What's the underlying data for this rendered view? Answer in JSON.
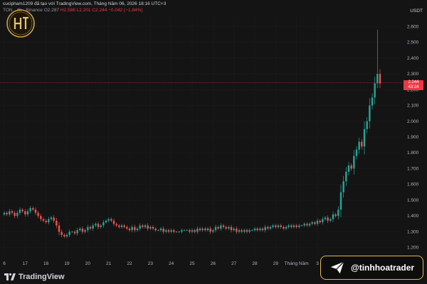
{
  "header": {
    "title": "cucipham1209 đã tạo với TradingView.com, Tháng Năm 06, 2026 18:16 UTC+3",
    "symbol_line": "TON · 4h · Binance",
    "ohlc": {
      "o": "O2.287",
      "h": "H2.586",
      "l": "L2.201",
      "c": "C2.244",
      "chg": "−0.042 (−1.84%)"
    },
    "currency": "USDT"
  },
  "price_tag": {
    "price": "2.244",
    "time": "43:24"
  },
  "footer": {
    "brand": "TradingView"
  },
  "badge": {
    "handle": "@tinhhoatrader",
    "icon": "send-icon"
  },
  "colors": {
    "up": "#26a69a",
    "down": "#ef5350",
    "bg": "#141414",
    "accent": "#e6b84a"
  },
  "chart_data": {
    "type": "candlestick",
    "y_ticks": [
      "2.600",
      "2.500",
      "2.400",
      "2.300",
      "2.200",
      "2.100",
      "2.000",
      "1.900",
      "1.800",
      "1.700",
      "1.600",
      "1.500",
      "1.400",
      "1.300",
      "1.200"
    ],
    "ylim": [
      1.14,
      2.66
    ],
    "x_ticks": [
      "6",
      "17",
      "18",
      "19",
      "20",
      "21",
      "22",
      "23",
      "24",
      "25",
      "26",
      "27",
      "28",
      "29",
      "Tháng Năm",
      "3"
    ],
    "last_price": 2.244,
    "closes": [
      1.42,
      1.41,
      1.43,
      1.42,
      1.4,
      1.42,
      1.44,
      1.43,
      1.41,
      1.43,
      1.45,
      1.44,
      1.42,
      1.4,
      1.38,
      1.37,
      1.36,
      1.38,
      1.39,
      1.37,
      1.34,
      1.3,
      1.28,
      1.27,
      1.28,
      1.3,
      1.3,
      1.29,
      1.31,
      1.32,
      1.3,
      1.31,
      1.33,
      1.32,
      1.34,
      1.35,
      1.33,
      1.34,
      1.36,
      1.37,
      1.38,
      1.37,
      1.35,
      1.34,
      1.33,
      1.34,
      1.33,
      1.32,
      1.31,
      1.33,
      1.31,
      1.32,
      1.34,
      1.33,
      1.34,
      1.32,
      1.33,
      1.32,
      1.31,
      1.31,
      1.32,
      1.3,
      1.31,
      1.3,
      1.31,
      1.3,
      1.3,
      1.3,
      1.31,
      1.31,
      1.31,
      1.3,
      1.31,
      1.3,
      1.32,
      1.31,
      1.32,
      1.31,
      1.32,
      1.3,
      1.31,
      1.33,
      1.32,
      1.34,
      1.33,
      1.32,
      1.33,
      1.31,
      1.32,
      1.3,
      1.31,
      1.3,
      1.31,
      1.3,
      1.31,
      1.31,
      1.32,
      1.31,
      1.32,
      1.31,
      1.33,
      1.32,
      1.33,
      1.34,
      1.33,
      1.34,
      1.33,
      1.32,
      1.33,
      1.34,
      1.33,
      1.34,
      1.33,
      1.34,
      1.34,
      1.35,
      1.34,
      1.35,
      1.36,
      1.35,
      1.37,
      1.36,
      1.38,
      1.39,
      1.37,
      1.38,
      1.41,
      1.4,
      1.44,
      1.55,
      1.62,
      1.68,
      1.72,
      1.7,
      1.78,
      1.82,
      1.87,
      1.84,
      1.95,
      2.0,
      2.1,
      2.15,
      2.24,
      2.3,
      2.24
    ]
  }
}
